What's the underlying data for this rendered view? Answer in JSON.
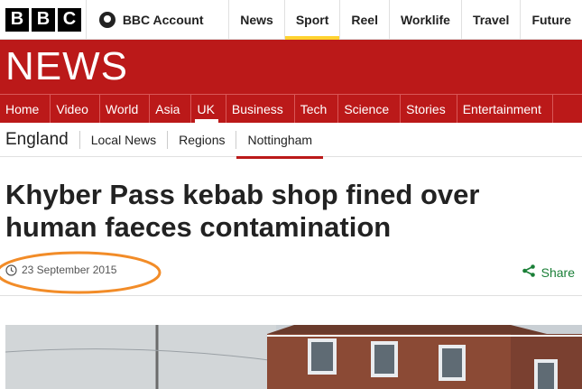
{
  "top": {
    "logo": [
      "B",
      "B",
      "C"
    ],
    "account_label": "BBC Account",
    "nav": [
      "News",
      "Sport",
      "Reel",
      "Worklife",
      "Travel",
      "Future"
    ]
  },
  "banner": {
    "title": "NEWS"
  },
  "section_nav": [
    "Home",
    "Video",
    "World",
    "Asia",
    "UK",
    "Business",
    "Tech",
    "Science",
    "Stories",
    "Entertainment"
  ],
  "section_active": "UK",
  "sub_nav": {
    "region": "England",
    "items": [
      "Local News",
      "Regions",
      "Nottingham"
    ],
    "active": "Nottingham"
  },
  "article": {
    "headline": "Khyber Pass kebab shop fined over human faeces contamination",
    "date": "23 September 2015",
    "share_label": "Share"
  },
  "colors": {
    "brand_red": "#bb1919",
    "sport_yellow": "#ffd230",
    "share_green": "#1a7f37",
    "annotation_orange": "#f28c28"
  },
  "icons": {
    "account": "account-icon",
    "clock": "clock-icon",
    "share": "share-icon"
  }
}
